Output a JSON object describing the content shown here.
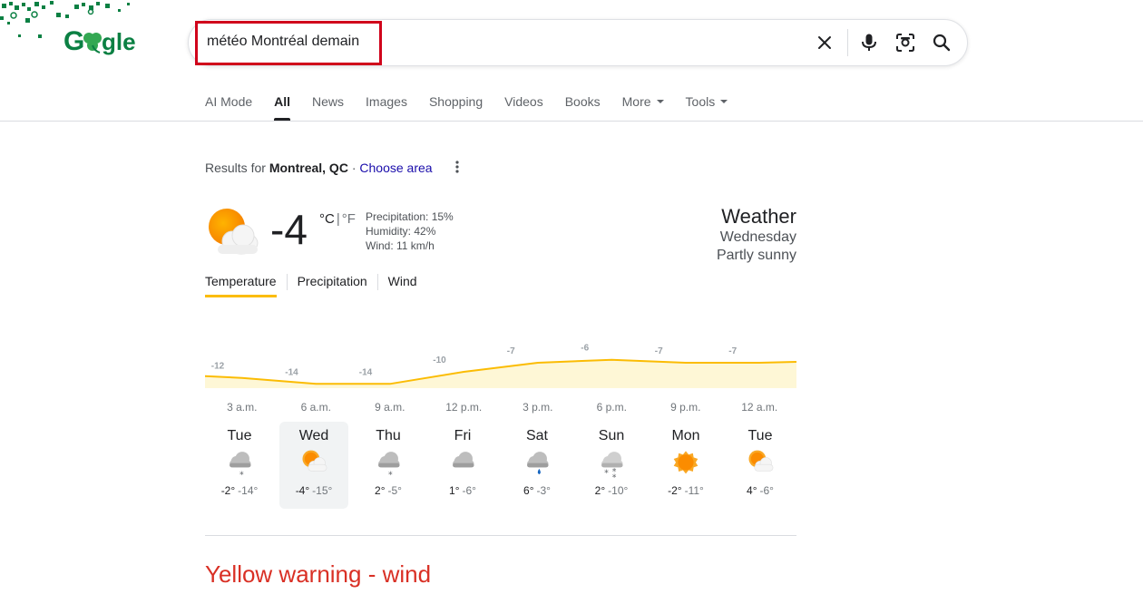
{
  "search": {
    "query": "météo Montréal demain"
  },
  "tabs": [
    {
      "label": "AI Mode",
      "active": false
    },
    {
      "label": "All",
      "active": true
    },
    {
      "label": "News",
      "active": false
    },
    {
      "label": "Images",
      "active": false
    },
    {
      "label": "Shopping",
      "active": false
    },
    {
      "label": "Videos",
      "active": false
    },
    {
      "label": "Books",
      "active": false
    },
    {
      "label": "More",
      "active": false,
      "dropdown": true
    },
    {
      "label": "Tools",
      "active": false,
      "dropdown": true
    }
  ],
  "results_for": {
    "prefix": "Results for",
    "location": "Montreal, QC",
    "dot": " · ",
    "link": "Choose area"
  },
  "current": {
    "temp": "-4",
    "unit_c": "°C",
    "sep": "|",
    "unit_f": "°F",
    "precipitation": "Precipitation: 15%",
    "humidity": "Humidity: 42%",
    "wind": "Wind: 11 km/h",
    "icon": "partly-sunny-icon"
  },
  "weather_header": {
    "title": "Weather",
    "day": "Wednesday",
    "condition": "Partly sunny"
  },
  "subtabs": [
    {
      "label": "Temperature",
      "active": true
    },
    {
      "label": "Precipitation",
      "active": false
    },
    {
      "label": "Wind",
      "active": false
    }
  ],
  "chart_data": {
    "type": "area",
    "x": [
      "3 a.m.",
      "6 a.m.",
      "9 a.m.",
      "12 p.m.",
      "3 p.m.",
      "6 p.m.",
      "9 p.m.",
      "12 a.m."
    ],
    "values": [
      -12,
      -14,
      -14,
      -10,
      -7,
      -6,
      -7,
      -7
    ],
    "colors": {
      "line": "#fbbc04",
      "fill": "#fef7d6"
    }
  },
  "days": [
    {
      "name": "Tue",
      "hi": "-2°",
      "lo": "-14°",
      "icon": "cloud-snow-icon",
      "selected": false
    },
    {
      "name": "Wed",
      "hi": "-4°",
      "lo": "-15°",
      "icon": "partly-sunny-icon",
      "selected": true
    },
    {
      "name": "Thu",
      "hi": "2°",
      "lo": "-5°",
      "icon": "cloud-snow-icon",
      "selected": false
    },
    {
      "name": "Fri",
      "hi": "1°",
      "lo": "-6°",
      "icon": "cloudy-icon",
      "selected": false
    },
    {
      "name": "Sat",
      "hi": "6°",
      "lo": "-3°",
      "icon": "cloud-rain-icon",
      "selected": false
    },
    {
      "name": "Sun",
      "hi": "2°",
      "lo": "-10°",
      "icon": "cloud-heavy-snow-icon",
      "selected": false
    },
    {
      "name": "Mon",
      "hi": "-2°",
      "lo": "-11°",
      "icon": "sunny-icon",
      "selected": false
    },
    {
      "name": "Tue",
      "hi": "4°",
      "lo": "-6°",
      "icon": "partly-sunny-icon",
      "selected": false
    }
  ],
  "warning": {
    "title": "Yellow warning - wind"
  },
  "colors": {
    "accent": "#fbbc04",
    "link": "#1a0dab",
    "warning": "#d93025",
    "highlight_box": "#d0021b"
  }
}
